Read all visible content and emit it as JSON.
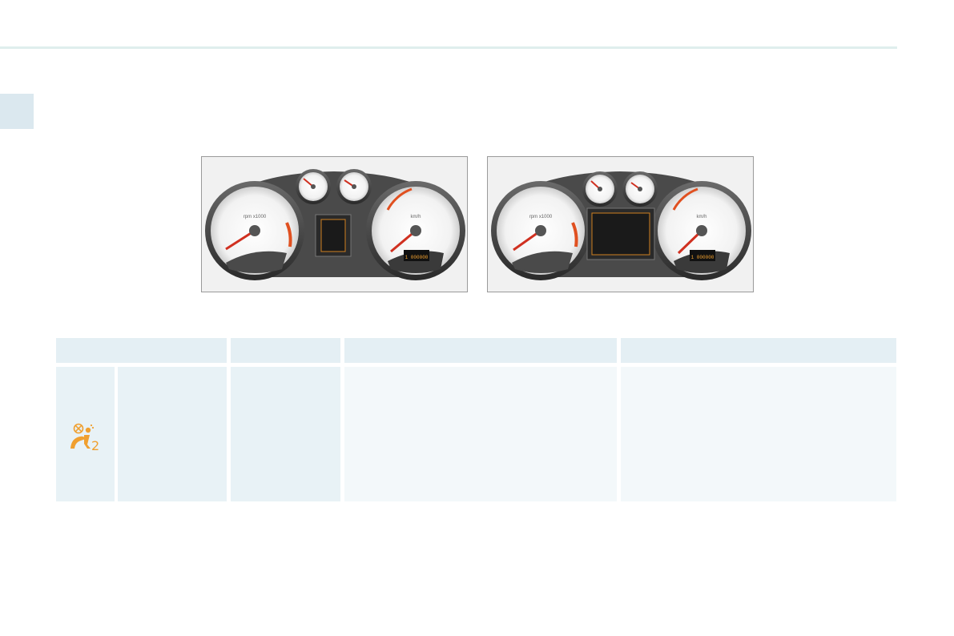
{
  "page": {
    "accent_color": "#f0a030",
    "panel_stroke": "#9a9a9a",
    "table_header_color": "#e4eff4",
    "table_cell_color": "#e8f2f6",
    "table_cell_light": "#f3f8fa"
  },
  "figures": {
    "left": {
      "description_icon": "instrument-cluster-small-screen",
      "tacho_label": "rpm x1000",
      "speedo_label": "km/h",
      "odometer": "1 000000"
    },
    "right": {
      "description_icon": "instrument-cluster-large-screen",
      "tacho_label": "rpm x1000",
      "speedo_label": "km/h",
      "odometer": "1 000000"
    }
  },
  "table": {
    "headers": [
      "",
      "",
      "",
      ""
    ],
    "row": {
      "icon": "passenger-airbag-off-icon",
      "icon_color": "#f0a030",
      "cells": [
        "",
        "",
        "",
        ""
      ]
    }
  }
}
